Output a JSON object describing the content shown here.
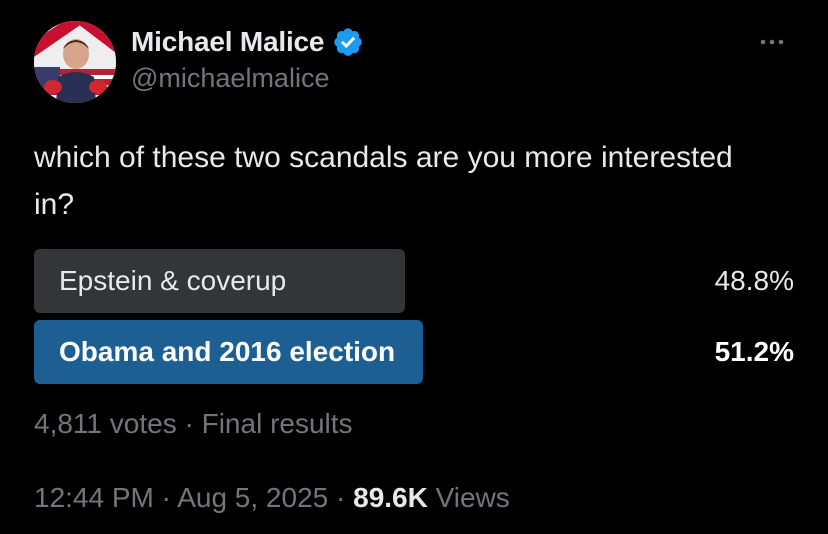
{
  "author": {
    "display_name": "Michael Malice",
    "handle": "@michaelmalice",
    "verified_icon": "verified-badge-icon",
    "verified_color": "#1d9bf0"
  },
  "tweet": {
    "text": "which of these two scandals are you more interested in?"
  },
  "poll": {
    "options": [
      {
        "label": "Epstein & coverup",
        "percent_label": "48.8%",
        "percent": 48.8,
        "winner": false
      },
      {
        "label": "Obama and 2016 election",
        "percent_label": "51.2%",
        "percent": 51.2,
        "winner": true
      }
    ],
    "votes_label": "4,811 votes",
    "separator": "·",
    "status_label": "Final results"
  },
  "meta": {
    "time": "12:44 PM",
    "separator": "·",
    "date": "Aug 5, 2025",
    "views_count": "89.6K",
    "views_label": "Views"
  },
  "colors": {
    "background": "#000000",
    "primary_text": "#e7e9ea",
    "secondary_text": "#71767b",
    "loser_bar": "#333639",
    "winner_bar": "#1d5f93"
  }
}
